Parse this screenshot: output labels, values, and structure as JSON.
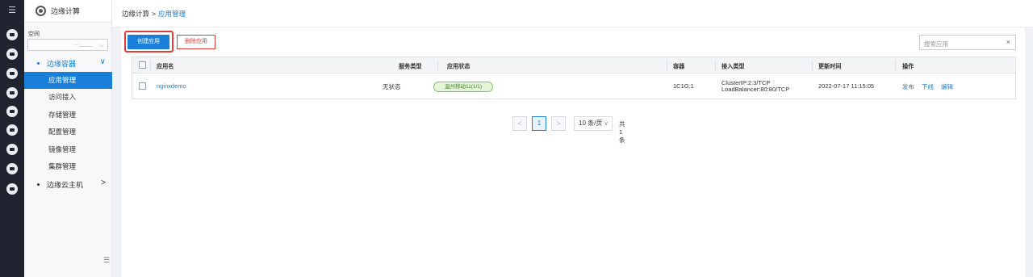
{
  "rail": {
    "menu_icon": "hamburger-menu-icon",
    "icons": [
      "app-circle-icon",
      "robot-icon",
      "network-icon",
      "edge-node-icon",
      "storage-icon",
      "config-icon",
      "cloud-icon",
      "mirror-icon",
      "cluster-icon"
    ]
  },
  "sidebar": {
    "title": "边缘计算",
    "namespace_label": "空间",
    "namespace_value": "....:_____",
    "group1": {
      "label": "边缘容器",
      "chevron": "∨"
    },
    "items": [
      {
        "label": "应用管理",
        "active": true
      },
      {
        "label": "访问接入",
        "active": false
      },
      {
        "label": "存储管理",
        "active": false
      },
      {
        "label": "配置管理",
        "active": false
      },
      {
        "label": "镜像管理",
        "active": false
      },
      {
        "label": "集群管理",
        "active": false
      }
    ],
    "group2": {
      "label": "边缘云主机",
      "chevron": ">"
    }
  },
  "breadcrumb": {
    "root": "边缘计算",
    "separator": ">",
    "current": "应用管理"
  },
  "toolbar": {
    "create_label": "创建应用",
    "delete_label": "删除应用",
    "search_placeholder": "搜索应用",
    "search_clear": "×"
  },
  "table": {
    "headers": {
      "name": "应用名",
      "service_type": "服务类型",
      "status": "应用状态",
      "container": "容器",
      "access_type": "接入类型",
      "updated": "更新时间",
      "actions": "操作"
    },
    "rows": [
      {
        "name": "nginxdemo",
        "service_type": "无状态",
        "status": "温州移动11(1/1)",
        "container": "1C1G:1",
        "access_line1": "ClusterIP:2:3/TCP",
        "access_line2": "LoadBalancer:80:80/TCP",
        "updated": "2022-07-17 11:15:05",
        "action_publish": "发布",
        "action_offline": "下线",
        "action_edit": "编辑"
      }
    ]
  },
  "pagination": {
    "prev": "<",
    "current_page": "1",
    "next": ">",
    "page_size": "10 条/页",
    "page_size_arrow": "∨",
    "total": "共1条"
  },
  "colors": {
    "primary": "#1a7fd9",
    "danger": "#e23c3c",
    "success": "#3f8a22",
    "rail": "#1f2430"
  }
}
